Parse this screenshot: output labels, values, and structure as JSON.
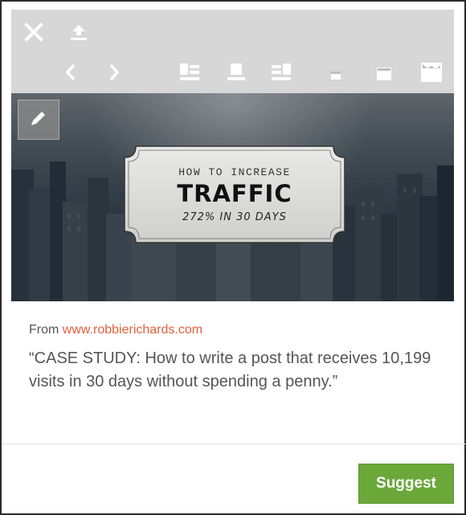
{
  "toolbar": {
    "icons": {
      "close": "close-icon",
      "share": "upload-icon",
      "prev": "chevron-left-icon",
      "next": "chevron-right-icon",
      "layout_left": "layout-image-left-icon",
      "layout_top": "layout-image-top-icon",
      "layout_right": "layout-image-right-icon",
      "size_small": "image-size-small-icon",
      "size_medium": "image-size-medium-icon",
      "size_large": "image-size-large-icon"
    }
  },
  "preview": {
    "edit_icon": "pencil-icon",
    "graphic_line1": "HOW TO INCREASE",
    "graphic_line2": "TRAFFIC",
    "graphic_line3": "272% IN 30 DAYS"
  },
  "source": {
    "prefix": "From",
    "link_text": "www.robbierichards.com"
  },
  "quote": "“CASE STUDY: How to write a post that receives 10,199 visits in 30 days without spending a penny.”",
  "actions": {
    "suggest_label": "Suggest"
  },
  "colors": {
    "toolbar_bg": "#d7d7d7",
    "link": "#e0603a",
    "suggest_bg": "#6aa83a",
    "text": "#555555"
  }
}
